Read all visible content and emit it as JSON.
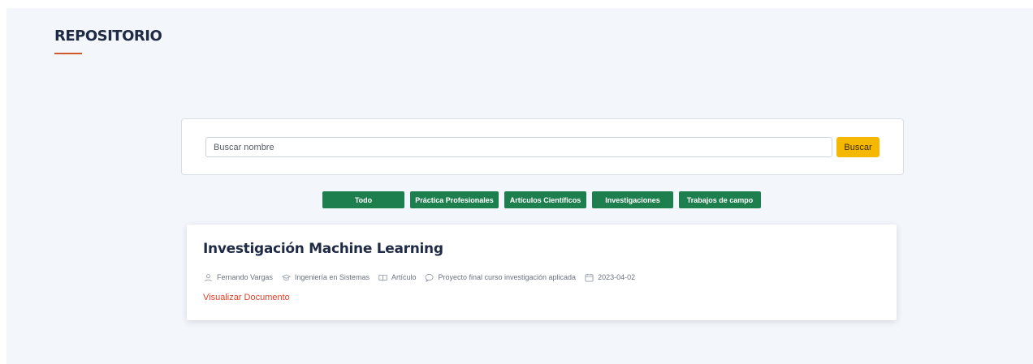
{
  "section": {
    "title": "REPOSITORIO"
  },
  "search": {
    "placeholder": "Buscar nombre",
    "value": "",
    "button_label": "Buscar"
  },
  "filters": [
    {
      "label": "Todo"
    },
    {
      "label": "Práctica Profesionales"
    },
    {
      "label": "Artículos Científicos"
    },
    {
      "label": "Investigaciones"
    },
    {
      "label": "Trabajos de campo"
    }
  ],
  "documents": [
    {
      "title": "Investigación Machine Learning",
      "author": "Fernando Vargas",
      "career": "Ingeniería en Sistemas",
      "type": "Artículo",
      "description": "Proyecto final curso investigación aplicada",
      "date": "2023-04-02",
      "link_label": "Visualizar Documento"
    }
  ],
  "icons": {
    "author": "user-icon",
    "career": "graduation-cap-icon",
    "type": "book-icon",
    "description": "comment-icon",
    "date": "calendar-icon"
  },
  "colors": {
    "accent_underline": "#d0562c",
    "search_button": "#f5b800",
    "filter_button": "#1d7f4d",
    "link": "#e0452b",
    "background": "#f3f6fb"
  }
}
